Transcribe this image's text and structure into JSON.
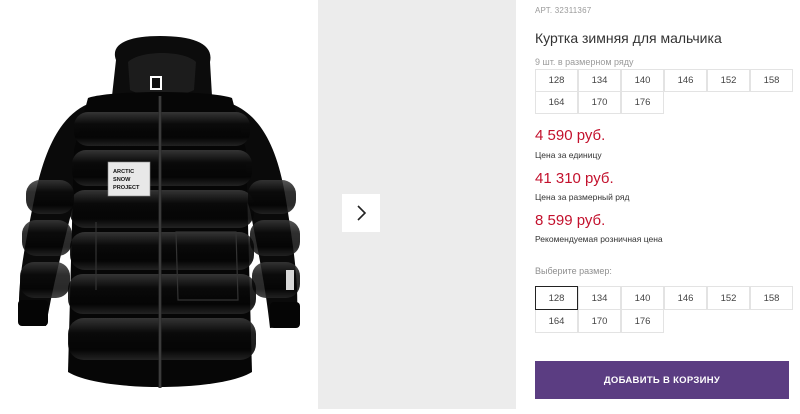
{
  "product": {
    "article_label": "АРТ.",
    "article_number": "32311367",
    "title": "Куртка зимняя для мальчика",
    "image_badge_text": [
      "ARCTIC",
      "SNOW",
      "PROJECT"
    ],
    "pack_note": "9 шт. в размерном ряду",
    "pack_sizes": [
      "128",
      "134",
      "140",
      "146",
      "152",
      "158",
      "164",
      "170",
      "176"
    ]
  },
  "pricing": {
    "unit_price": "4 590 руб.",
    "unit_note": "Цена за единицу",
    "row_price": "41 310 руб.",
    "row_note": "Цена за размерный ряд",
    "retail_price": "8 599 руб.",
    "retail_note": "Рекомендуемая розничная цена"
  },
  "size_selector": {
    "label": "Выберите размер:",
    "options": [
      "128",
      "134",
      "140",
      "146",
      "152",
      "158",
      "164",
      "170",
      "176"
    ],
    "selected": "128"
  },
  "cart_button": {
    "label": "ДОБАВИТЬ В КОРЗИНУ"
  },
  "colors": {
    "price": "#c3112d",
    "button": "#5b3d82",
    "thumb_bg": "#ececec"
  },
  "gallery": {
    "next_icon": "chevron-right-icon"
  }
}
